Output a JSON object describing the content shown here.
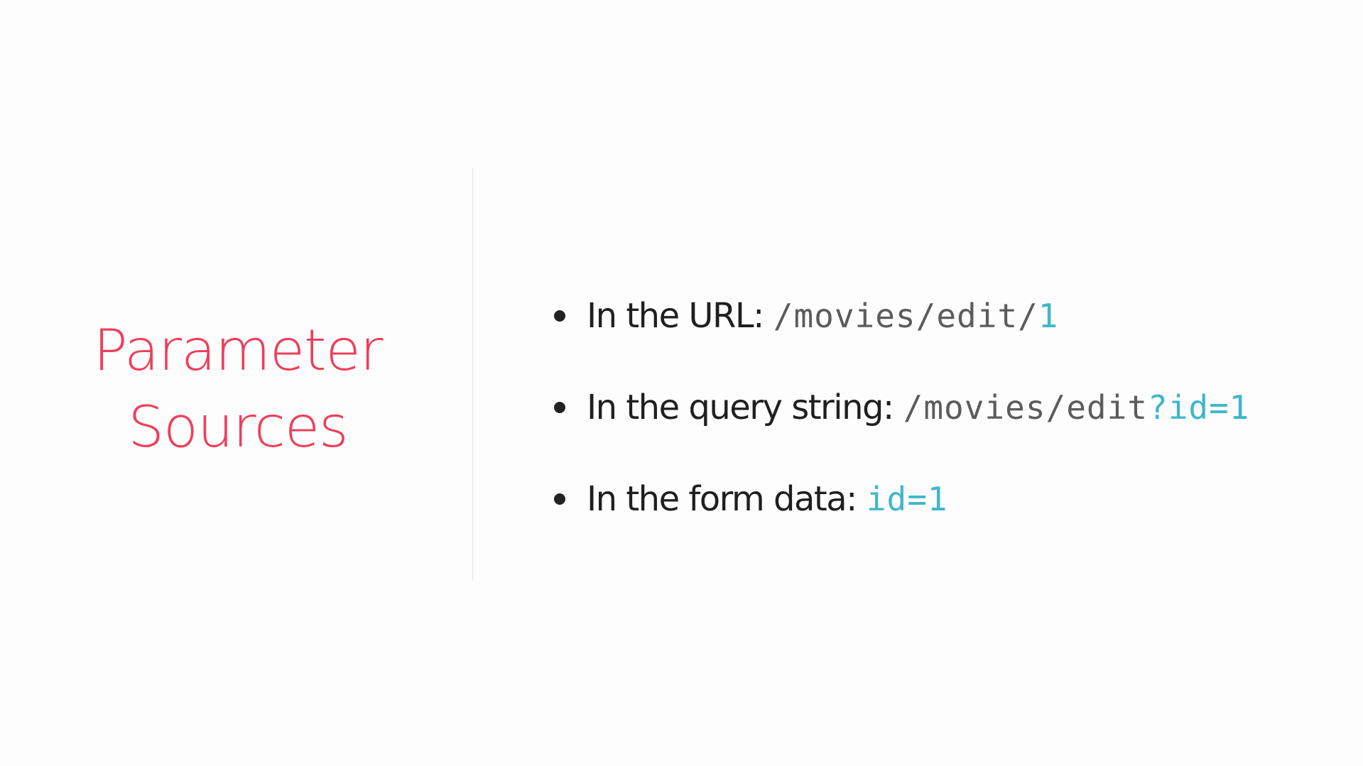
{
  "title": {
    "line1": "Parameter",
    "line2": "Sources",
    "color": "#ef3e5b"
  },
  "bullets": [
    {
      "label": "In the URL:",
      "code_path": "/movies/edit/",
      "code_value": "1"
    },
    {
      "label": "In the query string:",
      "code_path": "/movies/edit",
      "code_value": "?id=1"
    },
    {
      "label": "In the form data:",
      "code_path": "",
      "code_value": "id=1"
    }
  ],
  "colors": {
    "code_path": "#5c5c5c",
    "code_value": "#3fb6c9",
    "text": "#1f1f1f"
  }
}
